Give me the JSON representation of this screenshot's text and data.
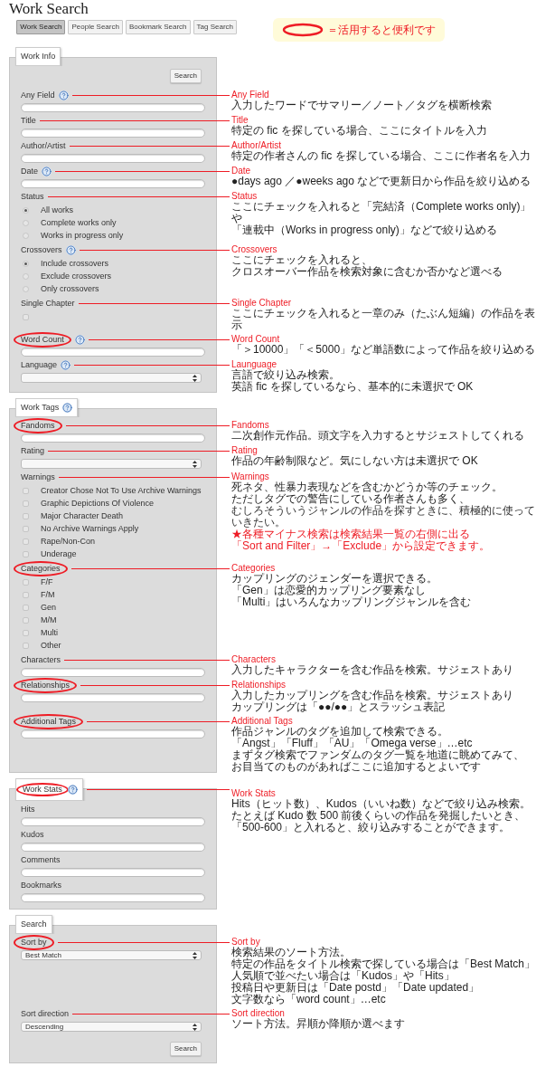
{
  "title": "Work Search",
  "tabs": [
    {
      "label": "Work Search",
      "selected": true
    },
    {
      "label": "People Search",
      "selected": false
    },
    {
      "label": "Bookmark Search",
      "selected": false
    },
    {
      "label": "Tag Search",
      "selected": false
    }
  ],
  "legend": {
    "text": "＝活用すると便利です"
  },
  "sections": [
    {
      "heading": "Work Info",
      "help": false,
      "highlighted": false,
      "top_button": "Search",
      "fields": [
        {
          "label": "Any Field",
          "help": true,
          "highlighted": false,
          "kind": "text",
          "annotation": {
            "title": "Any Field",
            "lines": [
              "入力したワードでサマリー／ノート／タグを横断検索"
            ]
          }
        },
        {
          "label": "Title",
          "help": false,
          "highlighted": false,
          "kind": "text",
          "annotation": {
            "title": "Title",
            "lines": [
              "特定の fic を探している場合、ここにタイトルを入力"
            ]
          }
        },
        {
          "label": "Author/Artist",
          "help": false,
          "highlighted": false,
          "kind": "text",
          "annotation": {
            "title": "Author/Artist",
            "lines": [
              "特定の作者さんの fic を探している場合、ここに作者名を入力"
            ]
          }
        },
        {
          "label": "Date",
          "help": true,
          "highlighted": false,
          "kind": "text",
          "annotation": {
            "title": "Date",
            "lines": [
              "●days ago ／●weeks ago などで更新日から作品を絞り込める"
            ]
          }
        },
        {
          "label": "Status",
          "help": false,
          "highlighted": false,
          "kind": "radio",
          "options": [
            {
              "label": "All works",
              "selected": true
            },
            {
              "label": "Complete works only",
              "selected": false
            },
            {
              "label": "Works in progress only",
              "selected": false
            }
          ],
          "annotation": {
            "title": "Status",
            "lines": [
              "ここにチェックを入れると「完結済（Complete works only)」や",
              "「連載中（Works in progress only)」などで絞り込める"
            ]
          }
        },
        {
          "label": "Crossovers",
          "help": true,
          "highlighted": false,
          "kind": "radio",
          "options": [
            {
              "label": "Include crossovers",
              "selected": true
            },
            {
              "label": "Exclude crossovers",
              "selected": false
            },
            {
              "label": "Only crossovers",
              "selected": false
            }
          ],
          "annotation": {
            "title": "Crossovers",
            "lines": [
              "ここにチェックを入れると、",
              "クロスオーバー作品を検索対象に含むか否かなど選べる"
            ]
          }
        },
        {
          "label": "Single Chapter",
          "help": false,
          "highlighted": false,
          "kind": "single_checkbox",
          "checked": false,
          "annotation": {
            "title": "Single Chapter",
            "lines": [
              "ここにチェックを入れると一章のみ（たぶん短編）の作品を表示"
            ]
          }
        },
        {
          "label": "Word Count",
          "help": true,
          "highlighted": true,
          "kind": "text",
          "annotation": {
            "title": "Word Count",
            "lines": [
              "「＞10000」「＜5000」など単語数によって作品を絞り込める"
            ]
          }
        },
        {
          "label": "Language",
          "help": true,
          "highlighted": false,
          "kind": "select",
          "annotation": {
            "title": "Launguage",
            "lines": [
              "言語で絞り込み検索。",
              "英語 fic を探しているなら、基本的に未選択で OK"
            ]
          }
        }
      ]
    },
    {
      "heading": "Work Tags",
      "help": true,
      "highlighted": false,
      "fields": [
        {
          "label": "Fandoms",
          "help": false,
          "highlighted": true,
          "kind": "text",
          "annotation": {
            "title": "Fandoms",
            "lines": [
              "二次創作元作品。頭文字を入力するとサジェストしてくれる"
            ]
          }
        },
        {
          "label": "Rating",
          "help": false,
          "highlighted": false,
          "kind": "select",
          "annotation": {
            "title": "Rating",
            "lines": [
              "作品の年齢制限など。気にしない方は未選択で OK"
            ]
          }
        },
        {
          "label": "Warnings",
          "help": false,
          "highlighted": false,
          "kind": "checkbox",
          "options": [
            {
              "label": "Creator Chose Not To Use Archive Warnings",
              "checked": false
            },
            {
              "label": "Graphic Depictions Of Violence",
              "checked": false
            },
            {
              "label": "Major Character Death",
              "checked": false
            },
            {
              "label": "No Archive Warnings Apply",
              "checked": false
            },
            {
              "label": "Rape/Non-Con",
              "checked": false
            },
            {
              "label": "Underage",
              "checked": false
            }
          ],
          "annotation": {
            "title": "Warnings",
            "lines": [
              "死ネタ、性暴力表現などを含むかどうか等のチェック。",
              "ただしタグでの警告にしている作者さんも多く、"
            ],
            "fine_print": "むしろそういうジャンルの作品を探すときに、積極的に使っていきたい。",
            "notes": [
              "★各種マイナス検索は検索結果一覧の右側に出る",
              "「Sort and Filter」→「Exclude」から設定できます。"
            ]
          }
        },
        {
          "label": "Categories",
          "help": false,
          "highlighted": true,
          "kind": "checkbox",
          "options": [
            {
              "label": "F/F",
              "checked": false
            },
            {
              "label": "F/M",
              "checked": false
            },
            {
              "label": "Gen",
              "checked": false
            },
            {
              "label": "M/M",
              "checked": false
            },
            {
              "label": "Multi",
              "checked": false
            },
            {
              "label": "Other",
              "checked": false
            }
          ],
          "annotation": {
            "title": "Categories",
            "lines": [
              "カップリングのジェンダーを選択できる。",
              "「Gen」は恋愛的カップリング要素なし",
              "「Multi」はいろんなカップリングジャンルを含む"
            ]
          }
        },
        {
          "label": "Characters",
          "help": false,
          "highlighted": false,
          "kind": "text",
          "annotation": {
            "title": "Characters",
            "lines": [
              "入力したキャラクターを含む作品を検索。サジェストあり"
            ]
          }
        },
        {
          "label": "Relationships",
          "help": false,
          "highlighted": true,
          "kind": "text",
          "annotation": {
            "title": "Relationships",
            "lines": [
              "入力したカップリングを含む作品を検索。サジェストあり",
              "カップリングは「●●/●●」とスラッシュ表記"
            ]
          }
        },
        {
          "label": "Additional Tags",
          "help": false,
          "highlighted": true,
          "kind": "text",
          "annotation": {
            "title": "Additional Tags",
            "lines": [
              "作品ジャンルのタグを追加して検索できる。",
              "「Angst」「Fluff」「AU」「Omega verse」…etc",
              "まずタグ検索でファンダムのタグ一覧を地道に眺めてみて、",
              "お目当てのものがあればここに追加するとよいです"
            ]
          }
        }
      ]
    },
    {
      "heading": "Work Stats",
      "help": true,
      "highlighted": true,
      "annotation": {
        "title": "Work Stats",
        "lines": [
          "Hits（ヒット数）、Kudos（いいね数）などで絞り込み検索。",
          "たとえば Kudo 数 500 前後くらいの作品を発掘したいとき、",
          "「500-600」と入れると、絞り込みすることができます。"
        ]
      },
      "fields": [
        {
          "label": "Hits",
          "help": false,
          "highlighted": false,
          "kind": "text"
        },
        {
          "label": "Kudos",
          "help": false,
          "highlighted": false,
          "kind": "text"
        },
        {
          "label": "Comments",
          "help": false,
          "highlighted": false,
          "kind": "text"
        },
        {
          "label": "Bookmarks",
          "help": false,
          "highlighted": false,
          "kind": "text"
        }
      ]
    },
    {
      "heading": "Search",
      "help": false,
      "highlighted": false,
      "bottom_button": "Search",
      "fields": [
        {
          "label": "Sort by",
          "help": false,
          "highlighted": true,
          "kind": "select",
          "value": "Best Match",
          "annotation": {
            "title": "Sort by",
            "lines": [
              "検索結果のソート方法。",
              "特定の作品をタイトル検索で探している場合は「Best Match」",
              "人気順で並べたい場合は「Kudos」や「Hits」",
              "投稿日や更新日は「Date postd」「Date updated」",
              "文字数なら「word count」…etc"
            ]
          }
        },
        {
          "label": "Sort direction",
          "help": false,
          "highlighted": false,
          "kind": "select",
          "value": "Descending",
          "annotation": {
            "title": "Sort direction",
            "lines": [
              "ソート方法。昇順か降順か選べます"
            ]
          }
        }
      ]
    }
  ]
}
